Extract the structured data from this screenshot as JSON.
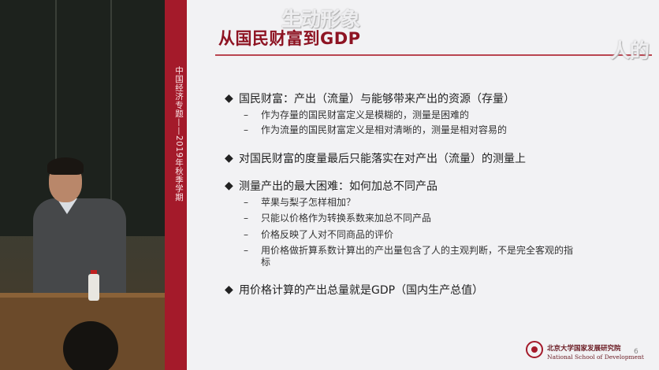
{
  "sidebar": {
    "label": "中国经济专题——2019年秋季学期"
  },
  "slide": {
    "title": "从国民财富到GDP",
    "bullet_symbol": "◆",
    "dash_symbol": "–",
    "bullets": [
      {
        "text": "国民财富：产出（流量）与能够带来产出的资源（存量）",
        "subs": [
          "作为存量的国民财富定义是模糊的，测量是困难的",
          "作为流量的国民财富定义是相对清晰的，测量是相对容易的"
        ]
      },
      {
        "text": "对国民财富的度量最后只能落实在对产出（流量）的测量上",
        "subs": []
      },
      {
        "text": "测量产出的最大困难：如何加总不同产品",
        "subs": [
          "苹果与梨子怎样相加？",
          "只能以价格作为转换系数来加总不同产品",
          "价格反映了人对不同商品的评价",
          "用价格做折算系数计算出的产出量包含了人的主观判断，不是完全客观的指",
          "标"
        ]
      },
      {
        "text": "用价格计算的产出总量就是GDP（国内生产总值）",
        "subs": []
      }
    ],
    "logo_cn": "北京大学国家发展研究院",
    "logo_en": "National School of Development",
    "page_number": "6"
  },
  "watermark": {
    "line1": "生动形象",
    "line2": "人的"
  },
  "colors": {
    "accent": "#a41a2a",
    "title": "#8e1423",
    "slide_bg": "#f2f2f4"
  }
}
